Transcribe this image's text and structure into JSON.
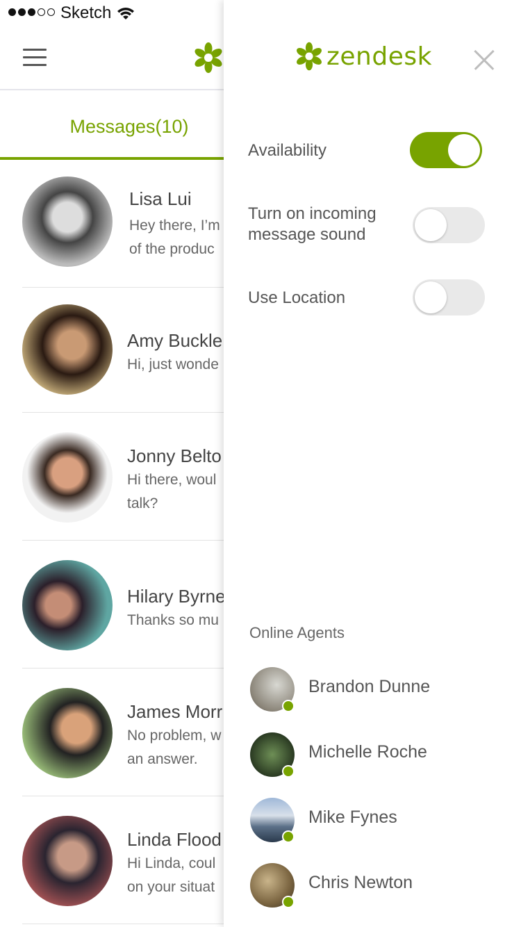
{
  "status_bar": {
    "carrier": "Sketch"
  },
  "brand": {
    "logo_text": "zendesk",
    "color": "#78a300"
  },
  "tabs": {
    "messages_label": "Messages(10)"
  },
  "conversations": [
    {
      "name": "Lisa Lui",
      "line1": "Hey there, I’m",
      "line2": "of the produc"
    },
    {
      "name": "Amy Buckle",
      "line1": "Hi, just wonde",
      "line2": ""
    },
    {
      "name": "Jonny Belto",
      "line1": "Hi there, woul",
      "line2": "talk?"
    },
    {
      "name": "Hilary Byrne",
      "line1": "Thanks so mu",
      "line2": ""
    },
    {
      "name": "James Morr",
      "line1": "No problem, w",
      "line2": "an answer."
    },
    {
      "name": "Linda Flood",
      "line1": "Hi Linda, coul",
      "line2": "on your situat"
    }
  ],
  "settings": {
    "availability_label": "Availability",
    "availability_on": true,
    "sound_label_line1": "Turn on incoming",
    "sound_label_line2": "message sound",
    "sound_on": false,
    "location_label": "Use Location",
    "location_on": false
  },
  "online_agents": {
    "title": "Online Agents",
    "agents": [
      "Brandon Dunne",
      "Michelle Roche",
      "Mike Fynes",
      "Chris Newton"
    ]
  }
}
